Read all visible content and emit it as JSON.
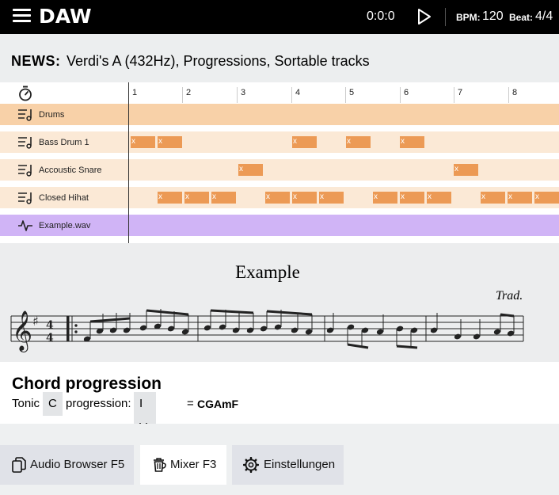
{
  "header": {
    "logo": "DAW",
    "time": "0:0:0",
    "bpm_label": "BPM:",
    "bpm_value": "120",
    "beat_label": "Beat:",
    "beat_value": "4/4"
  },
  "news": {
    "label": "NEWS:",
    "text": "Verdi's A (432Hz), Progressions, Sortable tracks"
  },
  "ruler": {
    "bars": [
      "1",
      "2",
      "3",
      "4",
      "5",
      "6",
      "7",
      "8"
    ]
  },
  "tracks": [
    {
      "name": "Drums",
      "type": "group",
      "color": "#f8d1a8"
    },
    {
      "name": "Bass Drum 1",
      "type": "midi",
      "color": "#fbe9d6"
    },
    {
      "name": "Accoustic Snare",
      "type": "midi",
      "color": "#fbe9d6"
    },
    {
      "name": "Closed Hihat",
      "type": "midi",
      "color": "#fbe9d6"
    },
    {
      "name": "Example.wav",
      "type": "audio",
      "color": "#d0b4f6"
    }
  ],
  "note_color": "#ec9a55",
  "note_label": "x",
  "score": {
    "title": "Example",
    "composer": "Trad."
  },
  "chord": {
    "title": "Chord progression",
    "tonic_label": "Tonic",
    "tonic_value": "C",
    "progression_label": "progression:",
    "progression_value": "I V vi IV",
    "equals": "=",
    "result": "CGAmF"
  },
  "tabs": [
    {
      "label": "Audio Browser F5",
      "icon": "files-icon",
      "active": false
    },
    {
      "label": "Mixer F3",
      "icon": "trash-mixer-icon",
      "active": true
    },
    {
      "label": "Einstellungen",
      "icon": "gear-icon",
      "active": false
    }
  ]
}
